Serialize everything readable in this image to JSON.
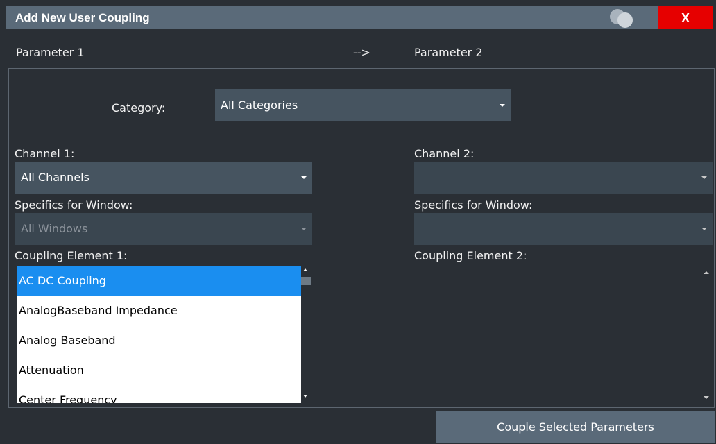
{
  "window": {
    "title": "Add New User Coupling",
    "close_label": "X"
  },
  "header": {
    "param1": "Parameter 1",
    "arrow": "-->",
    "param2": "Parameter 2"
  },
  "category": {
    "label": "Category:",
    "value": "All Categories"
  },
  "left": {
    "channel_label": "Channel 1:",
    "channel_value": "All Channels",
    "window_label": "Specifics for Window:",
    "window_value": "All Windows",
    "element_label": "Coupling Element 1:",
    "elements": [
      "AC DC Coupling",
      "AnalogBaseband Impedance",
      "Analog Baseband",
      "Attenuation",
      "Center Frequency"
    ]
  },
  "right": {
    "channel_label": "Channel 2:",
    "channel_value": "",
    "window_label": "Specifics for Window:",
    "window_value": "",
    "element_label": "Coupling Element 2:"
  },
  "footer": {
    "couple_button": "Couple Selected Parameters"
  },
  "colors": {
    "background": "#2a2f35",
    "titlebar": "#5a6a79",
    "close": "#e60000",
    "selection": "#1a8ef0"
  }
}
